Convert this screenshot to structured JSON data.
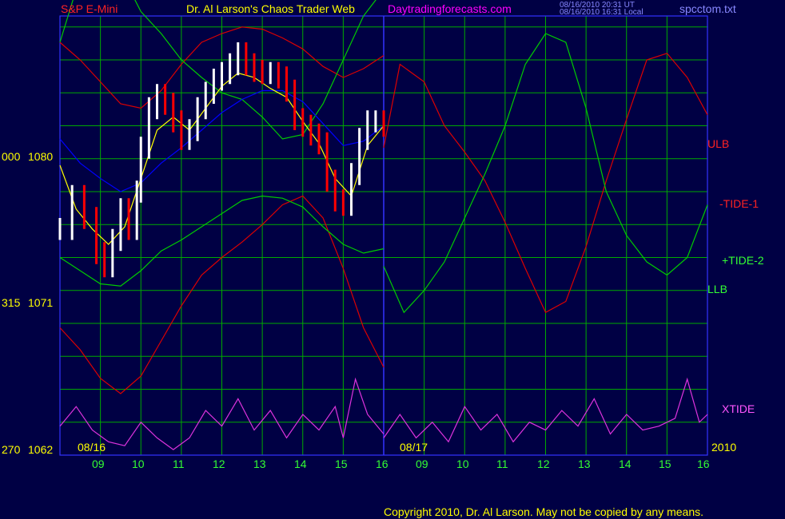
{
  "header": {
    "symbol": "S&P E-Mini",
    "title": "Dr. Al Larson's Chaos Trader Web",
    "site": "Daytradingforecasts.com",
    "stamp_ut": "08/16/2010 20:31 UT",
    "stamp_local": "08/16/2010 16:31 Local",
    "filename": "spcctom.txt"
  },
  "footer": {
    "copyright": "Copyright 2010, Dr. Al Larson. May not be copied by any means."
  },
  "colors": {
    "background": "#000044",
    "grid": "#00aa00",
    "frame": "#3333ff",
    "ulb": "#dd0000",
    "tide1": "#dd0000",
    "tide2": "#00cc00",
    "llb": "#00cc00",
    "xtide": "#dd33dd",
    "price_up": "#ffffff",
    "price_down": "#ff0000",
    "avg_fast": "#ffff00",
    "avg_slow": "#0000ff",
    "title_red": "#ff2222",
    "title_yellow": "#ffff00",
    "title_magenta": "#ff00ff",
    "time_labels": "#00ff00",
    "price_labels": "#ffff00",
    "stamp": "#8888ff"
  },
  "chart_data": {
    "type": "line",
    "x_unit": "hour of day",
    "y_range": [
      1062,
      1082
    ],
    "grid": true,
    "y_ticks": [
      {
        "y": 1080,
        "label_left": "000",
        "label_right": "1080"
      },
      {
        "y": 1071,
        "label_left": "315",
        "label_right": "1071"
      },
      {
        "y": 1062,
        "label_left": "270",
        "label_right": "1062"
      }
    ],
    "x_ticks_day1": [
      "09",
      "10",
      "11",
      "12",
      "13",
      "14",
      "15",
      "16"
    ],
    "x_ticks_day2": [
      "09",
      "10",
      "11",
      "12",
      "13",
      "14",
      "15",
      "16"
    ],
    "date_labels": [
      "08/16",
      "08/17",
      "2010"
    ],
    "legend": [
      "ULB",
      "-TIDE-1",
      "+TIDE-2",
      "LLB",
      "XTIDE"
    ],
    "series": [
      {
        "name": "ULB",
        "day": 1,
        "x": [
          8.0,
          8.5,
          9.0,
          9.5,
          10.0,
          10.5,
          11.0,
          11.5,
          12.0,
          12.5,
          13.0,
          13.5,
          14.0,
          14.5,
          15.0,
          15.5,
          16.0
        ],
        "y": [
          1080.8,
          1080.0,
          1079.0,
          1078.0,
          1077.8,
          1078.6,
          1079.8,
          1080.8,
          1081.2,
          1081.5,
          1081.4,
          1081.0,
          1080.5,
          1079.7,
          1079.2,
          1079.6,
          1080.2
        ]
      },
      {
        "name": "-TIDE-1",
        "day": 1,
        "x": [
          8.0,
          8.5,
          9.0,
          9.5,
          10.0,
          10.5,
          11.0,
          11.5,
          12.0,
          12.5,
          13.0,
          13.5,
          14.0,
          14.5,
          15.0,
          15.5,
          16.0
        ],
        "y": [
          1067.8,
          1066.8,
          1065.5,
          1064.8,
          1065.6,
          1067.2,
          1068.8,
          1070.2,
          1071.0,
          1071.7,
          1072.5,
          1073.4,
          1073.8,
          1072.8,
          1070.5,
          1067.8,
          1066.0
        ]
      },
      {
        "name": "+TIDE-2",
        "day": 1,
        "x": [
          8.0,
          8.5,
          9.0,
          9.5,
          10.0,
          10.5,
          11.0,
          11.5,
          12.0,
          12.5,
          13.0,
          13.5,
          14.0,
          14.5,
          15.0,
          15.5,
          16.0
        ],
        "y": [
          1080.8,
          1083.8,
          1085.0,
          1084.0,
          1082.2,
          1081.2,
          1080.0,
          1079.2,
          1078.5,
          1078.2,
          1077.4,
          1076.4,
          1076.6,
          1078.0,
          1080.0,
          1082.0,
          1083.2
        ]
      },
      {
        "name": "LLB",
        "day": 1,
        "x": [
          8.0,
          8.5,
          9.0,
          9.5,
          10.0,
          10.5,
          11.0,
          11.5,
          12.0,
          12.5,
          13.0,
          13.5,
          14.0,
          14.5,
          15.0,
          15.5,
          16.0
        ],
        "y": [
          1071.0,
          1070.4,
          1069.8,
          1069.7,
          1070.4,
          1071.3,
          1071.8,
          1072.4,
          1073.0,
          1073.6,
          1073.8,
          1073.7,
          1073.3,
          1072.4,
          1071.6,
          1071.2,
          1071.4
        ]
      },
      {
        "name": "-TIDE-1",
        "day": 2,
        "x": [
          8.0,
          8.4,
          9.0,
          9.5,
          10.0,
          10.5,
          11.0,
          11.5,
          12.0,
          12.5,
          13.0,
          13.5,
          14.0,
          14.5,
          15.0,
          15.5,
          16.0
        ],
        "y": [
          1076.0,
          1079.8,
          1079.0,
          1077.0,
          1075.8,
          1074.5,
          1072.6,
          1070.5,
          1068.5,
          1069.0,
          1071.5,
          1074.5,
          1077.3,
          1080.0,
          1080.3,
          1079.2,
          1077.5
        ]
      },
      {
        "name": "+TIDE-2",
        "day": 2,
        "x": [
          8.0,
          8.5,
          9.0,
          9.5,
          10.0,
          10.5,
          11.0,
          11.5,
          12.0,
          12.5,
          13.0,
          13.5,
          14.0,
          14.5,
          15.0,
          15.5,
          16.0
        ],
        "y": [
          1070.6,
          1068.5,
          1069.5,
          1070.8,
          1072.8,
          1074.8,
          1077.0,
          1079.8,
          1081.2,
          1080.8,
          1077.8,
          1074.0,
          1072.0,
          1070.8,
          1070.2,
          1071.0,
          1073.4
        ]
      },
      {
        "name": "XTIDE",
        "day": 1,
        "x": [
          8.0,
          8.4,
          8.8,
          9.2,
          9.6,
          10.0,
          10.4,
          10.8,
          11.2,
          11.6,
          12.0,
          12.4,
          12.8,
          13.2,
          13.6,
          14.0,
          14.4,
          14.8,
          15.0,
          15.3,
          15.6,
          16.0
        ],
        "y": [
          0.35,
          0.6,
          0.3,
          0.15,
          0.1,
          0.4,
          0.2,
          0.05,
          0.2,
          0.55,
          0.35,
          0.7,
          0.3,
          0.55,
          0.2,
          0.5,
          0.3,
          0.6,
          0.2,
          0.95,
          0.5,
          0.25
        ]
      },
      {
        "name": "XTIDE",
        "day": 2,
        "x": [
          8.0,
          8.4,
          8.8,
          9.2,
          9.6,
          10.0,
          10.4,
          10.8,
          11.2,
          11.6,
          12.0,
          12.4,
          12.8,
          13.2,
          13.6,
          14.0,
          14.4,
          14.8,
          15.2,
          15.5,
          15.8,
          16.0
        ],
        "y": [
          0.2,
          0.5,
          0.2,
          0.4,
          0.15,
          0.6,
          0.3,
          0.5,
          0.15,
          0.4,
          0.3,
          0.55,
          0.35,
          0.7,
          0.25,
          0.5,
          0.3,
          0.35,
          0.45,
          0.95,
          0.4,
          0.5
        ]
      }
    ],
    "price": {
      "name": "S&P E-Mini",
      "day": 1,
      "x": [
        8.0,
        8.3,
        8.6,
        8.9,
        9.1,
        9.3,
        9.5,
        9.7,
        9.9,
        10.0,
        10.2,
        10.4,
        10.6,
        10.8,
        11.0,
        11.2,
        11.4,
        11.6,
        11.8,
        12.0,
        12.2,
        12.4,
        12.6,
        12.8,
        13.0,
        13.2,
        13.4,
        13.6,
        13.8,
        14.0,
        14.2,
        14.4,
        14.6,
        14.8,
        15.0,
        15.2,
        15.4,
        15.6,
        15.8,
        16.0
      ],
      "y": [
        1072.3,
        1073.8,
        1072.8,
        1071.2,
        1070.6,
        1071.8,
        1073.2,
        1072.3,
        1074.0,
        1076.0,
        1077.8,
        1078.4,
        1078.0,
        1077.2,
        1076.4,
        1076.8,
        1077.8,
        1078.5,
        1079.1,
        1079.4,
        1079.8,
        1080.3,
        1079.8,
        1079.5,
        1079.4,
        1079.4,
        1079.2,
        1078.6,
        1077.3,
        1077.0,
        1076.6,
        1076.2,
        1074.5,
        1073.6,
        1073.4,
        1074.8,
        1076.4,
        1077.2,
        1077.2,
        1077.0
      ]
    },
    "avg_fast": {
      "day": 1,
      "x": [
        8.0,
        8.4,
        8.8,
        9.2,
        9.6,
        10.0,
        10.4,
        10.8,
        11.2,
        11.6,
        12.0,
        12.4,
        12.8,
        13.2,
        13.6,
        14.0,
        14.4,
        14.8,
        15.2,
        15.6,
        16.0
      ],
      "y": [
        1075.2,
        1073.2,
        1072.3,
        1071.6,
        1072.4,
        1074.6,
        1076.8,
        1077.4,
        1076.8,
        1077.8,
        1078.8,
        1079.4,
        1079.2,
        1078.7,
        1078.3,
        1077.2,
        1076.2,
        1074.6,
        1073.8,
        1076.1,
        1077.0
      ]
    },
    "avg_slow": {
      "day": 1,
      "x": [
        8.0,
        8.5,
        9.0,
        9.5,
        10.0,
        10.5,
        11.0,
        11.5,
        12.0,
        12.5,
        13.0,
        13.5,
        14.0,
        14.5,
        15.0,
        15.5,
        16.0
      ],
      "y": [
        1076.4,
        1075.3,
        1074.6,
        1074.0,
        1074.4,
        1075.3,
        1076.0,
        1076.8,
        1077.6,
        1078.2,
        1078.6,
        1078.6,
        1078.1,
        1077.1,
        1076.1,
        1076.3,
        1077.0
      ]
    }
  }
}
